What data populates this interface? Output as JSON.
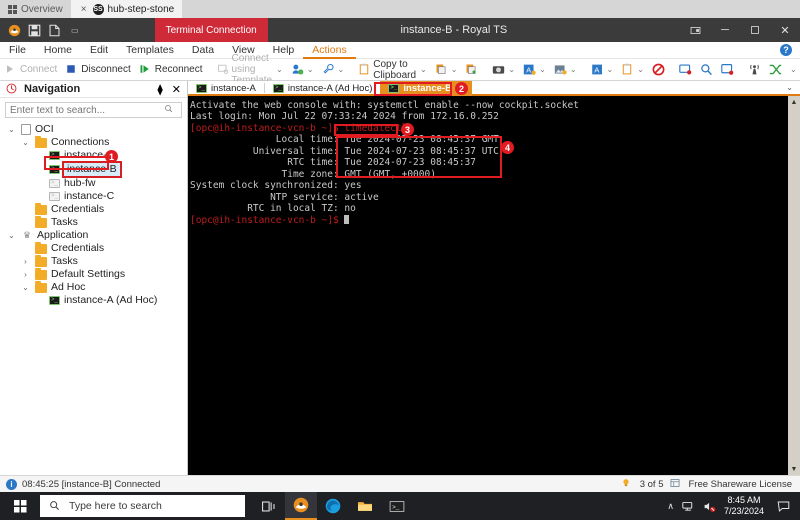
{
  "browser_tabs": {
    "tabs": [
      {
        "label": "Overview",
        "icon": "grid-icon",
        "active": false
      },
      {
        "label": "hub-step-stone",
        "icon": "favicon-ss",
        "active": true
      }
    ],
    "close_glyph": "×"
  },
  "titlebar": {
    "quick_access": [
      "royal-ts-logo-icon",
      "save-icon",
      "new-document-icon",
      "customize-caret-icon"
    ],
    "context_tab": "Terminal Connection",
    "title": "instance-B - Royal TS",
    "buttons": {
      "ribbon_display": "▭",
      "minimize": "─",
      "maximize": "❐",
      "close": "✕"
    }
  },
  "menubar": {
    "items": [
      {
        "label": "File",
        "active": false
      },
      {
        "label": "Home",
        "active": false
      },
      {
        "label": "Edit",
        "active": false
      },
      {
        "label": "Templates",
        "active": false
      },
      {
        "label": "Data",
        "active": false
      },
      {
        "label": "View",
        "active": false
      },
      {
        "label": "Help",
        "active": false
      },
      {
        "label": "Actions",
        "active": true
      }
    ],
    "help_glyph": "?"
  },
  "ribbon": {
    "connect": "Connect",
    "disconnect": "Disconnect",
    "reconnect": "Reconnect",
    "connect_using_template": "Connect using Template",
    "copy_to_clipboard": "Copy to Clipboard",
    "caret": "⌄",
    "overflow_caret": "⌄"
  },
  "navigation": {
    "title": "Navigation",
    "pin_glyph": "⧫",
    "close_glyph": "✕",
    "search": {
      "placeholder": "Enter text to search...",
      "value": "",
      "icon": "search-icon"
    },
    "tree": [
      {
        "indent": 0,
        "twisty": "⌄",
        "icon": "doc-icon",
        "label": "OCI",
        "selected": false
      },
      {
        "indent": 1,
        "twisty": "⌄",
        "icon": "folder-icon",
        "label": "Connections",
        "selected": false
      },
      {
        "indent": 2,
        "twisty": "",
        "icon": "terminal-icon",
        "label": "instance-A",
        "selected": false
      },
      {
        "indent": 2,
        "twisty": "",
        "icon": "terminal-icon",
        "label": "instance-B",
        "selected": true
      },
      {
        "indent": 2,
        "twisty": "",
        "icon": "terminal-icon-grey",
        "label": "hub-fw",
        "selected": false
      },
      {
        "indent": 2,
        "twisty": "",
        "icon": "terminal-icon-grey",
        "label": "instance-C",
        "selected": false
      },
      {
        "indent": 1,
        "twisty": "",
        "icon": "folder-icon",
        "label": "Credentials",
        "selected": false
      },
      {
        "indent": 1,
        "twisty": "",
        "icon": "folder-icon",
        "label": "Tasks",
        "selected": false
      },
      {
        "indent": 0,
        "twisty": "⌄",
        "icon": "crown-icon",
        "label": "Application",
        "selected": false
      },
      {
        "indent": 1,
        "twisty": "",
        "icon": "folder-icon",
        "label": "Credentials",
        "selected": false
      },
      {
        "indent": 1,
        "twisty": "›",
        "icon": "folder-icon",
        "label": "Tasks",
        "selected": false
      },
      {
        "indent": 1,
        "twisty": "›",
        "icon": "folder-icon",
        "label": "Default Settings",
        "selected": false
      },
      {
        "indent": 1,
        "twisty": "⌄",
        "icon": "folder-icon",
        "label": "Ad Hoc",
        "selected": false
      },
      {
        "indent": 2,
        "twisty": "",
        "icon": "terminal-icon",
        "label": "instance-A (Ad Hoc)",
        "selected": false
      }
    ]
  },
  "session_tabs": {
    "tabs": [
      {
        "label": "instance-A",
        "active": false,
        "closable": false
      },
      {
        "label": "instance-A (Ad Hoc)",
        "active": false,
        "closable": false
      },
      {
        "label": "instance-B",
        "active": true,
        "closable": true
      }
    ],
    "close_glyph": "×",
    "overflow_caret": "⌄"
  },
  "terminal": {
    "lines": [
      "Activate the web console with: systemctl enable --now cockpit.socket",
      "",
      "Last login: Mon Jul 22 07:33:24 2024 from 172.16.0.252",
      "[opc@ih-instance-vcn-b ~]$ timedatectl",
      "               Local time: Tue 2024-07-23 08:45:37 GMT",
      "           Universal time: Tue 2024-07-23 08:45:37 UTC",
      "                 RTC time: Tue 2024-07-23 08:45:37",
      "                Time zone: GMT (GMT, +0000)",
      "System clock synchronized: yes",
      "              NTP service: active",
      "          RTC in local TZ: no",
      "[opc@ih-instance-vcn-b ~]$ "
    ],
    "scroll_up_glyph": "▲",
    "scroll_down_glyph": "▼"
  },
  "annotations": [
    {
      "number": "1",
      "target": "navigation-tree-item-instance-b"
    },
    {
      "number": "2",
      "target": "session-tab-instance-b"
    },
    {
      "number": "3",
      "target": "terminal-command-timedatectl"
    },
    {
      "number": "4",
      "target": "terminal-timedatectl-output"
    }
  ],
  "statusbar": {
    "message": "08:45:25 [instance-B] Connected",
    "info_glyph": "i",
    "connection_count": "3 of 5",
    "license": "Free Shareware License",
    "bulb_icon": "lightbulb-icon",
    "license_icon": "license-icon"
  },
  "taskbar": {
    "start_icon": "windows-start-icon",
    "search_placeholder": "Type here to search",
    "search_icon": "search-icon",
    "apps": [
      {
        "name": "task-view-icon",
        "active": false
      },
      {
        "name": "royal-ts-icon",
        "active": true
      },
      {
        "name": "microsoft-edge-icon",
        "active": false
      },
      {
        "name": "file-explorer-icon",
        "active": false
      },
      {
        "name": "terminal-icon",
        "active": false
      }
    ],
    "tray": {
      "chevron": "∧",
      "network_icon": "network-icon",
      "volume_icon": "volume-muted-icon",
      "time": "8:45 AM",
      "date": "7/23/2024",
      "action_center_icon": "action-center-icon"
    }
  },
  "colors": {
    "accent_orange": "#e8901f",
    "context_red": "#cf2a38",
    "annotation_red": "#e11b22",
    "terminal_bg": "#000000",
    "terminal_fg": "#c8c8c8",
    "titlebar_bg": "#3b3b3b"
  }
}
